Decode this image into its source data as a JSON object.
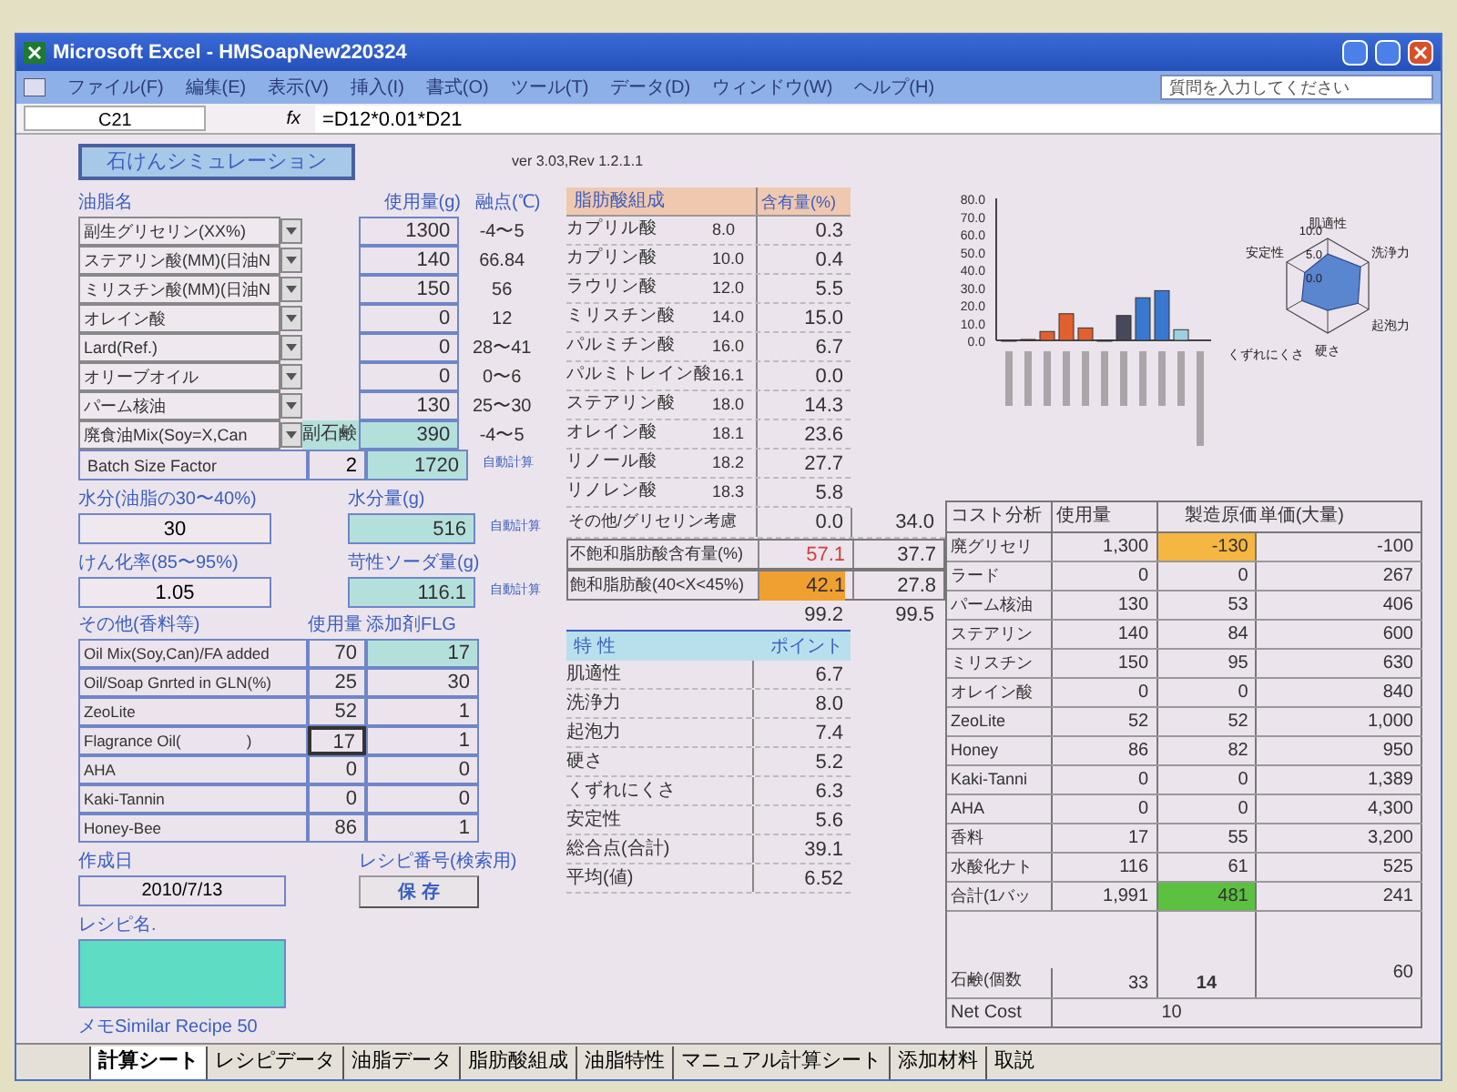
{
  "window": {
    "title": "Microsoft Excel - HMSoapNew220324"
  },
  "menu": [
    "ファイル(F)",
    "編集(E)",
    "表示(V)",
    "挿入(I)",
    "書式(O)",
    "ツール(T)",
    "データ(D)",
    "ウィンドウ(W)",
    "ヘルプ(H)"
  ],
  "help_box": {
    "placeholder": "質問を入力してください"
  },
  "formula_bar": {
    "cell": "C21",
    "fx": "fx",
    "formula": "=D12*0.01*D21"
  },
  "sheet": {
    "title_button": "石けんシミュレーション",
    "version": "ver 3.03,Rev 1.2.1.1",
    "oils": {
      "headers": [
        "油脂名",
        "使用量(g)",
        "融点(℃)"
      ],
      "rows": [
        {
          "name": "副生グリセリン(XX%)",
          "usage": "1300",
          "melt": "-4〜5"
        },
        {
          "name": "ステアリン酸(MM)(日油N",
          "usage": "140",
          "melt": "66.84"
        },
        {
          "name": "ミリスチン酸(MM)(日油N",
          "usage": "150",
          "melt": "56"
        },
        {
          "name": "オレイン酸",
          "usage": "0",
          "melt": "12"
        },
        {
          "name": "Lard(Ref.)",
          "usage": "0",
          "melt": "28〜41"
        },
        {
          "name": "オリーブオイル",
          "usage": "0",
          "melt": "0〜6"
        },
        {
          "name": "パーム核油",
          "usage": "130",
          "melt": "25〜30"
        },
        {
          "name": "廃食油Mix(Soy=X,Can",
          "side_label": "副石鹸",
          "usage": "390",
          "melt": "-4〜5"
        }
      ]
    },
    "batch": {
      "label": "Batch Size Factor",
      "factor": "2",
      "total": "1720",
      "note": "自動計算"
    },
    "water": {
      "label": "水分(油脂の30〜40%)",
      "value": "30",
      "amount_label": "水分量(g)",
      "amount": "516",
      "note": "自動計算"
    },
    "saponification": {
      "label": "けん化率(85〜95%)",
      "value": "1.05",
      "amount_label": "苛性ソーダ量(g)",
      "amount": "116.1",
      "note": "自動計算"
    },
    "additives": {
      "headers": [
        "その他(香料等)",
        "使用量",
        "添加剤FLG"
      ],
      "rows": [
        {
          "name": "Oil Mix(Soy,Can)/FA added",
          "usage": "70",
          "flag": "17",
          "selected": false
        },
        {
          "name": "Oil/Soap Gnrted in GLN(%)",
          "usage": "25",
          "flag": "30",
          "selected": false
        },
        {
          "name": "ZeoLite",
          "usage": "52",
          "flag": "1",
          "selected": false
        },
        {
          "name": "Flagrance Oil(　　　　)",
          "usage": "17",
          "flag": "1",
          "selected": true
        },
        {
          "name": "AHA",
          "usage": "0",
          "flag": "0",
          "selected": false
        },
        {
          "name": "Kaki-Tannin",
          "usage": "0",
          "flag": "0",
          "selected": false
        },
        {
          "name": "Honey-Bee",
          "usage": "86",
          "flag": "1",
          "selected": false
        }
      ]
    },
    "created": {
      "label": "作成日",
      "value": "2010/7/13"
    },
    "recipe_no": {
      "label": "レシピ番号(検索用)",
      "button": "保 存"
    },
    "recipe_name": {
      "label": "レシピ名."
    },
    "memo": "メモSimilar Recipe 50",
    "fatty_acids": {
      "headers": [
        "脂肪酸組成",
        "含有量(%)"
      ],
      "rows": [
        {
          "name": "カプリル酸",
          "carbon": "8.0",
          "percent": "0.3"
        },
        {
          "name": "カプリン酸",
          "carbon": "10.0",
          "percent": "0.4"
        },
        {
          "name": "ラウリン酸",
          "carbon": "12.0",
          "percent": "5.5"
        },
        {
          "name": "ミリスチン酸",
          "carbon": "14.0",
          "percent": "15.0"
        },
        {
          "name": "パルミチン酸",
          "carbon": "16.0",
          "percent": "6.7"
        },
        {
          "name": "パルミトレイン酸",
          "carbon": "16.1",
          "percent": "0.0"
        },
        {
          "name": "ステアリン酸",
          "carbon": "18.0",
          "percent": "14.3"
        },
        {
          "name": "オレイン酸",
          "carbon": "18.1",
          "percent": "23.6"
        },
        {
          "name": "リノール酸",
          "carbon": "18.2",
          "percent": "27.7"
        },
        {
          "name": "リノレン酸",
          "carbon": "18.3",
          "percent": "5.8"
        }
      ],
      "summary": [
        {
          "name": "その他/グリセリン考慮",
          "percent": "0.0",
          "extra": "34.0"
        },
        {
          "name": "不飽和脂肪酸含有量(%)",
          "percent": "57.1",
          "extra": "37.7"
        },
        {
          "name": "飽和脂肪酸(40<X<45%)",
          "percent": "42.1",
          "extra": "27.8",
          "color": "#f0a030"
        }
      ],
      "totals": [
        "99.2",
        "99.5"
      ]
    },
    "traits": {
      "headers": [
        "特 性",
        "ポイント"
      ],
      "rows": [
        {
          "name": "肌適性",
          "value": "6.7"
        },
        {
          "name": "洗浄力",
          "value": "8.0"
        },
        {
          "name": "起泡力",
          "value": "7.4"
        },
        {
          "name": "硬さ",
          "value": "5.2"
        },
        {
          "name": "くずれにくさ",
          "value": "6.3"
        },
        {
          "name": "安定性",
          "value": "5.6"
        },
        {
          "name": "総合点(合計)",
          "value": "39.1"
        },
        {
          "name": "平均(値)",
          "value": "6.52"
        }
      ]
    },
    "bar_chart": {
      "chart_data": {
        "type": "bar",
        "ylim": [
          0,
          80
        ],
        "yticks": [
          {
            "value": 0,
            "label": "0.0"
          },
          {
            "value": 10,
            "label": "10.0"
          },
          {
            "value": 20,
            "label": "20.0"
          },
          {
            "value": 30,
            "label": "30.0"
          },
          {
            "value": 40,
            "label": "40.0"
          },
          {
            "value": 50,
            "label": "50.0"
          },
          {
            "value": 60,
            "label": "60.0"
          },
          {
            "value": 70,
            "label": "70.0"
          },
          {
            "value": 80,
            "label": "80.0"
          }
        ],
        "series": [
          {
            "color": "#e06030",
            "values": [
              0,
              0.5,
              5,
              15,
              7,
              0,
              null,
              null,
              null,
              null,
              null
            ]
          },
          {
            "color": "#484858",
            "values": [
              null,
              null,
              null,
              null,
              null,
              null,
              14,
              null,
              null,
              null,
              null
            ]
          },
          {
            "color": "#3a78d0",
            "values": [
              null,
              null,
              null,
              null,
              null,
              null,
              null,
              24,
              28,
              null,
              null
            ]
          },
          {
            "color": "#9cd0e0",
            "values": [
              null,
              null,
              null,
              null,
              null,
              null,
              null,
              null,
              null,
              6,
              null
            ]
          }
        ]
      }
    },
    "radar": {
      "labels": [
        "肌適性",
        "安定性",
        "洗浄力",
        "くずれにくさ",
        "起泡力",
        "硬さ"
      ],
      "ticks": [
        "10.0",
        "5.0",
        "0.0"
      ]
    },
    "cost": {
      "headers": [
        "コスト分析",
        "使用量",
        "製造原価",
        "単価(大量)"
      ],
      "rows": [
        {
          "name": "廃グリセリ",
          "usage": "1,300",
          "cost": "-130",
          "unit": "-100",
          "color": "#f5b642"
        },
        {
          "name": "ラード",
          "usage": "0",
          "cost": "0",
          "unit": "267"
        },
        {
          "name": "パーム核油",
          "usage": "130",
          "cost": "53",
          "unit": "406"
        },
        {
          "name": "ステアリン",
          "usage": "140",
          "cost": "84",
          "unit": "600"
        },
        {
          "name": "ミリスチン",
          "usage": "150",
          "cost": "95",
          "unit": "630"
        },
        {
          "name": "オレイン酸",
          "usage": "0",
          "cost": "0",
          "unit": "840"
        },
        {
          "name": "ZeoLite",
          "usage": "52",
          "cost": "52",
          "unit": "1,000"
        },
        {
          "name": "Honey",
          "usage": "86",
          "cost": "82",
          "unit": "950"
        },
        {
          "name": "Kaki-Tanni",
          "usage": "0",
          "cost": "0",
          "unit": "1,389"
        },
        {
          "name": "AHA",
          "usage": "0",
          "cost": "0",
          "unit": "4,300"
        },
        {
          "name": "香料",
          "usage": "17",
          "cost": "55",
          "unit": "3,200"
        },
        {
          "name": "水酸化ナト",
          "usage": "116",
          "cost": "61",
          "unit": "525"
        },
        {
          "name": "合計(1バッ",
          "usage": "1,991",
          "cost": "481",
          "unit": "241",
          "color": "#5cc040"
        }
      ],
      "pieces": {
        "name": "石鹸(個数",
        "usage": "33",
        "cost": "14",
        "unit": "60"
      },
      "net": {
        "name": "Net Cost",
        "value": "10"
      }
    }
  },
  "sheet_tabs": [
    {
      "label": "計算シート",
      "selected": true
    },
    {
      "label": "レシピデータ",
      "selected": false
    },
    {
      "label": "油脂データ",
      "selected": false
    },
    {
      "label": "脂肪酸組成",
      "selected": false
    },
    {
      "label": "油脂特性",
      "selected": false
    },
    {
      "label": "マニュアル計算シート",
      "selected": false
    },
    {
      "label": "添加材料",
      "selected": false
    },
    {
      "label": "取説",
      "selected": false
    }
  ]
}
